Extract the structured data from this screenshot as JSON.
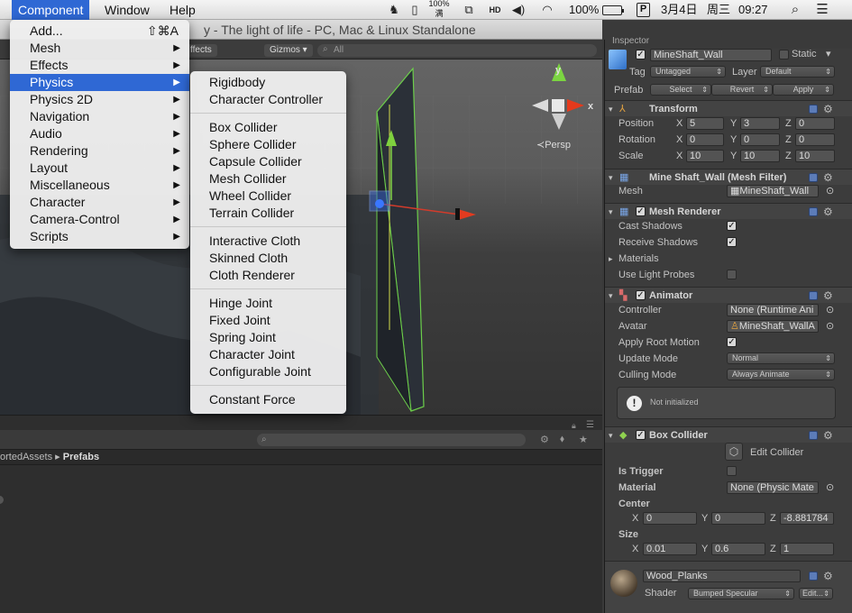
{
  "menubar": {
    "menus": [
      "Component",
      "Window",
      "Help"
    ],
    "active_menu": "Component",
    "battery_percent": "100%",
    "status_icon_text": "100%\n满",
    "input_method": "P",
    "date": "3月4日",
    "weekday": "周三",
    "time": "09:27"
  },
  "window": {
    "title": "y - The light of life - PC, Mac & Linux Standalone"
  },
  "scene": {
    "effects_label": "ffects",
    "gizmos_label": "Gizmos",
    "search_placeholder": "All",
    "persp_label": "Persp",
    "axis_y": "y",
    "axis_x": "x"
  },
  "component_menu": {
    "items": [
      {
        "label": "Add...",
        "shortcut": "⇧⌘A",
        "submenu": false
      },
      {
        "label": "Mesh",
        "submenu": true
      },
      {
        "label": "Effects",
        "submenu": true
      },
      {
        "label": "Physics",
        "submenu": true,
        "selected": true
      },
      {
        "label": "Physics 2D",
        "submenu": true
      },
      {
        "label": "Navigation",
        "submenu": true
      },
      {
        "label": "Audio",
        "submenu": true
      },
      {
        "label": "Rendering",
        "submenu": true
      },
      {
        "label": "Layout",
        "submenu": true
      },
      {
        "label": "Miscellaneous",
        "submenu": true
      },
      {
        "label": "Character",
        "submenu": true
      },
      {
        "label": "Camera-Control",
        "submenu": true
      },
      {
        "label": "Scripts",
        "submenu": true
      }
    ]
  },
  "physics_menu": {
    "groups": [
      [
        "Rigidbody",
        "Character Controller"
      ],
      [
        "Box Collider",
        "Sphere Collider",
        "Capsule Collider",
        "Mesh Collider",
        "Wheel Collider",
        "Terrain Collider"
      ],
      [
        "Interactive Cloth",
        "Skinned Cloth",
        "Cloth Renderer"
      ],
      [
        "Hinge Joint",
        "Fixed Joint",
        "Spring Joint",
        "Character Joint",
        "Configurable Joint"
      ],
      [
        "Constant Force"
      ]
    ]
  },
  "project": {
    "breadcrumb": [
      "ortedAssets",
      "Prefabs"
    ]
  },
  "inspector": {
    "tab_label": "Inspector",
    "object_name": "MineShaft_Wall",
    "static_label": "Static",
    "tag_label": "Tag",
    "tag_value": "Untagged",
    "layer_label": "Layer",
    "layer_value": "Default",
    "prefab_label": "Prefab",
    "prefab_buttons": [
      "Select",
      "Revert",
      "Apply"
    ],
    "transform": {
      "title": "Transform",
      "rows": [
        {
          "label": "Position",
          "x": "5",
          "y": "3",
          "z": "0"
        },
        {
          "label": "Rotation",
          "x": "0",
          "y": "0",
          "z": "0"
        },
        {
          "label": "Scale",
          "x": "10",
          "y": "10",
          "z": "10"
        }
      ]
    },
    "mesh_filter": {
      "title": "Mine Shaft_Wall (Mesh Filter)",
      "mesh_label": "Mesh",
      "mesh_value": "MineShaft_Wall"
    },
    "mesh_renderer": {
      "title": "Mesh Renderer",
      "cast_shadows": "Cast Shadows",
      "receive_shadows": "Receive Shadows",
      "materials": "Materials",
      "use_light_probes": "Use Light Probes"
    },
    "animator": {
      "title": "Animator",
      "controller_label": "Controller",
      "controller_value": "None (Runtime Ani",
      "avatar_label": "Avatar",
      "avatar_value": "MineShaft_WallA",
      "apply_root_motion": "Apply Root Motion",
      "update_mode_label": "Update Mode",
      "update_mode_value": "Normal",
      "culling_mode_label": "Culling Mode",
      "culling_mode_value": "Always Animate",
      "warning": "Not initialized"
    },
    "box_collider": {
      "title": "Box Collider",
      "edit_collider": "Edit Collider",
      "is_trigger": "Is Trigger",
      "material_label": "Material",
      "material_value": "None (Physic Mate",
      "center_label": "Center",
      "center": {
        "x": "0",
        "y": "0",
        "z": "-8.881784"
      },
      "size_label": "Size",
      "size": {
        "x": "0.01",
        "y": "0.6",
        "z": "1"
      }
    },
    "material": {
      "name": "Wood_Planks",
      "shader_label": "Shader",
      "shader_value": "Bumped Specular",
      "edit_button": "Edit..."
    }
  }
}
